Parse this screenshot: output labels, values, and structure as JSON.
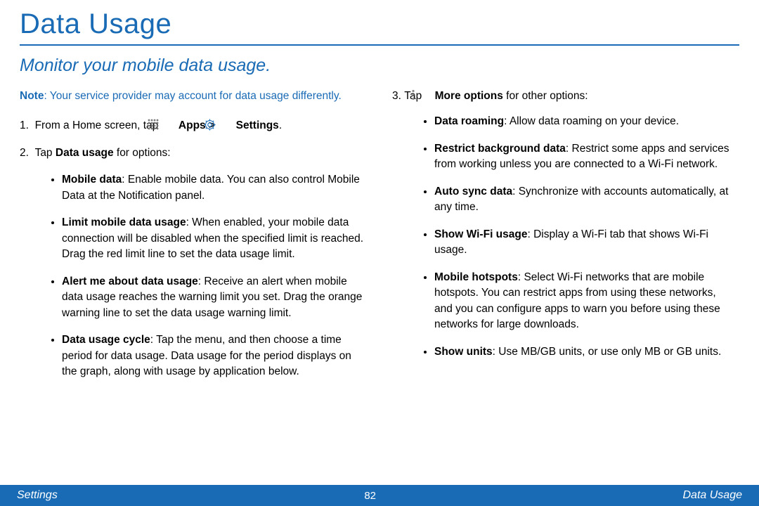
{
  "title": "Data Usage",
  "subtitle": "Monitor your mobile data usage.",
  "note": {
    "label": "Note",
    "text": ": Your service provider may account for data usage differently."
  },
  "steps": {
    "s1": {
      "num": "1.",
      "pre": "From a Home screen, tap ",
      "apps": "Apps >",
      "settings": "Settings",
      "post": "."
    },
    "s2": {
      "num": "2.",
      "pre_a": "Tap ",
      "b": "Data usage",
      "pre_b": " for options:"
    },
    "s3": {
      "num": "3.",
      "pre": "Tap ",
      "b": "More options",
      "post": " for other options:"
    }
  },
  "left_bullets": [
    {
      "term": "Mobile data",
      "desc": ": Enable mobile data. You can also control Mobile Data at the Notification panel."
    },
    {
      "term": "Limit mobile data usage",
      "desc": ": When enabled, your mobile data connection will be disabled when the specified limit is reached. Drag the red limit line to set the data usage limit."
    },
    {
      "term": "Alert me about data usage",
      "desc": ": Receive an alert when mobile data usage reaches the warning limit you set. Drag the orange warning line to set the data usage warning limit."
    },
    {
      "term": "Data usage cycle",
      "desc": ": Tap the menu, and then choose a time period for data usage. Data usage for the period displays on the graph, along with usage by application below."
    }
  ],
  "right_bullets": [
    {
      "term": "Data roaming",
      "desc": ": Allow data roaming on your device."
    },
    {
      "term": "Restrict background data",
      "desc": ": Restrict some apps and services from working unless you are connected to a Wi-Fi network."
    },
    {
      "term": "Auto sync data",
      "desc": ": Synchronize  with accounts automatically, at any time."
    },
    {
      "term": "Show Wi-Fi usage",
      "desc": ": Display a Wi-Fi tab that shows Wi-Fi usage."
    },
    {
      "term": "Mobile hotspots",
      "desc": ": Select Wi-Fi networks that are mobile hotspots. You can restrict apps from using these networks, and you can configure apps to warn you before using these networks for large downloads."
    },
    {
      "term": "Show units",
      "desc": ": Use MB/GB units, or use only MB or GB units."
    }
  ],
  "footer": {
    "left": "Settings",
    "page": "82",
    "right": "Data Usage"
  }
}
